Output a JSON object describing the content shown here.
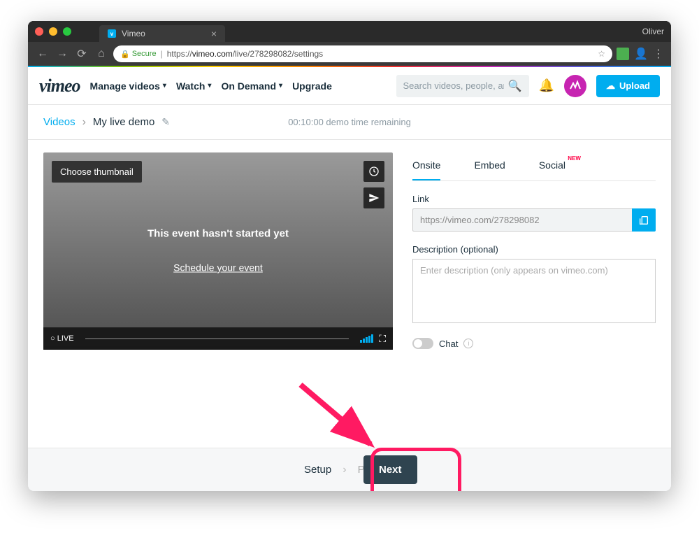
{
  "browser": {
    "tab_title": "Vimeo",
    "user_label": "Oliver",
    "secure_label": "Secure",
    "url_prefix": "https://",
    "url_host": "vimeo.com",
    "url_path": "/live/278298082/settings"
  },
  "header": {
    "logo_text": "vimeo",
    "nav_manage": "Manage videos",
    "nav_watch": "Watch",
    "nav_ondemand": "On Demand",
    "nav_upgrade": "Upgrade",
    "search_placeholder": "Search videos, people, and more",
    "upload_label": "Upload"
  },
  "breadcrumb": {
    "root": "Videos",
    "title": "My live demo",
    "demo_time": "00:10:00  demo time remaining"
  },
  "preview": {
    "choose_thumb": "Choose thumbnail",
    "event_text": "This event hasn't started yet",
    "schedule_link": "Schedule your event",
    "live_label": "LIVE"
  },
  "right": {
    "tab_onsite": "Onsite",
    "tab_embed": "Embed",
    "tab_social": "Social",
    "new_badge": "NEW",
    "link_label": "Link",
    "link_value": "https://vimeo.com/278298082",
    "desc_label": "Description (optional)",
    "desc_placeholder": "Enter description (only appears on vimeo.com)",
    "chat_label": "Chat"
  },
  "footer": {
    "setup": "Setup",
    "preview": "Preview",
    "next": "Next"
  }
}
